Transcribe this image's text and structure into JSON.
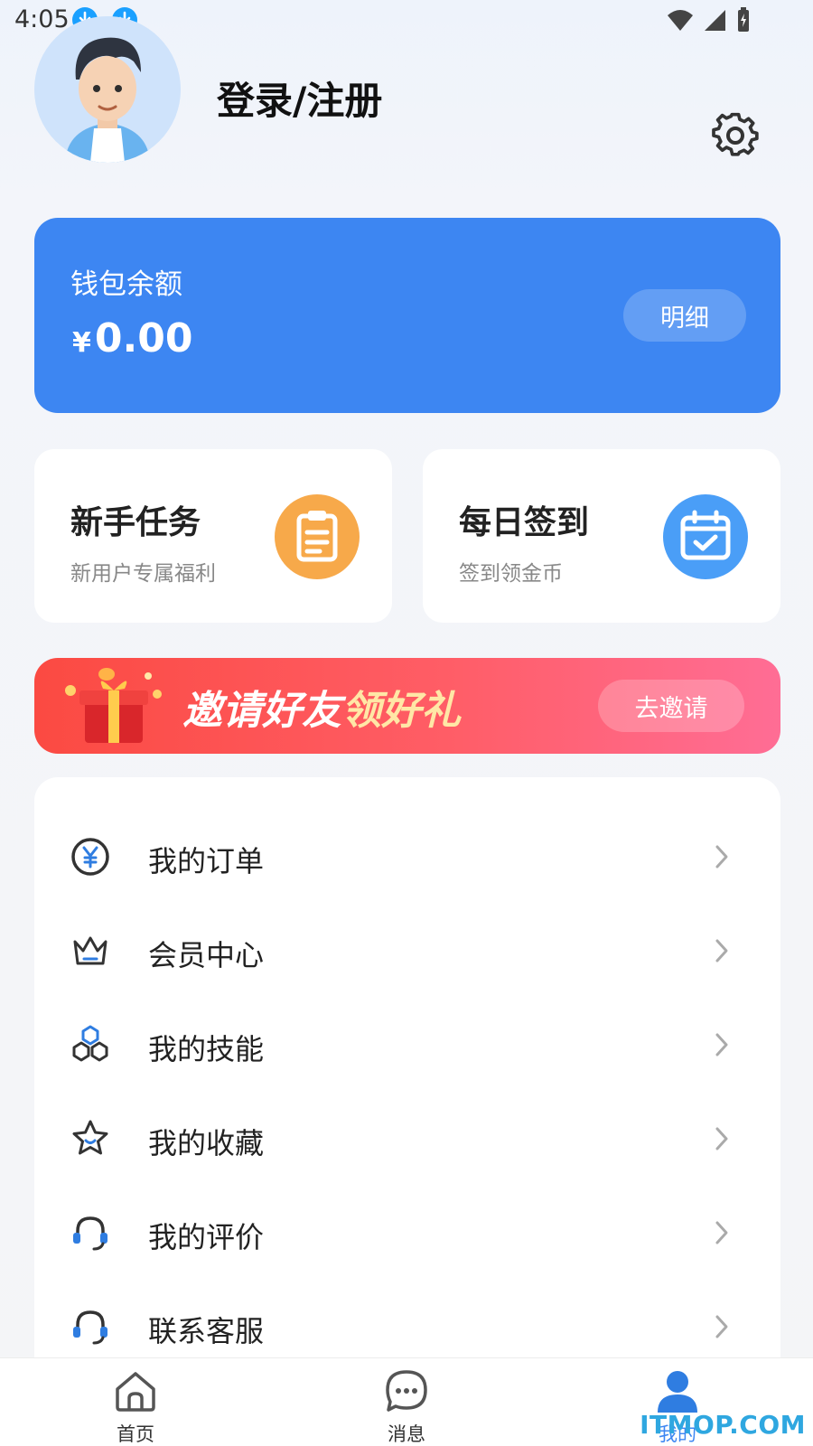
{
  "status_bar": {
    "time": "4:05"
  },
  "header": {
    "title": "登录/注册",
    "settings_icon": "gear-icon"
  },
  "wallet": {
    "label": "钱包余额",
    "currency": "¥",
    "amount": "0.00",
    "detail_label": "明细",
    "color": "#3d86f2"
  },
  "cards": [
    {
      "title": "新手任务",
      "subtitle": "新用户专属福利",
      "icon": "clipboard-icon",
      "icon_color": "#f7a94a"
    },
    {
      "title": "每日签到",
      "subtitle": "签到领金币",
      "icon": "calendar-check-icon",
      "icon_color": "#4a9ef7"
    }
  ],
  "banner": {
    "text_main": "邀请好友",
    "text_accent": "领好礼",
    "button_label": "去邀请"
  },
  "menu": {
    "items": [
      {
        "label": "我的订单",
        "icon": "yen-circle-icon"
      },
      {
        "label": "会员中心",
        "icon": "crown-icon"
      },
      {
        "label": "我的技能",
        "icon": "hexagons-icon"
      },
      {
        "label": "我的收藏",
        "icon": "star-icon"
      },
      {
        "label": "我的评价",
        "icon": "headset-icon"
      },
      {
        "label": "联系客服",
        "icon": "headset-icon"
      }
    ]
  },
  "bottom_nav": {
    "items": [
      {
        "label": "首页",
        "icon": "home-icon"
      },
      {
        "label": "消息",
        "icon": "chat-bubble-icon"
      },
      {
        "label": "我的",
        "icon": "user-icon",
        "active": true
      }
    ]
  },
  "watermark": {
    "brand": "ITMOP.COM"
  }
}
